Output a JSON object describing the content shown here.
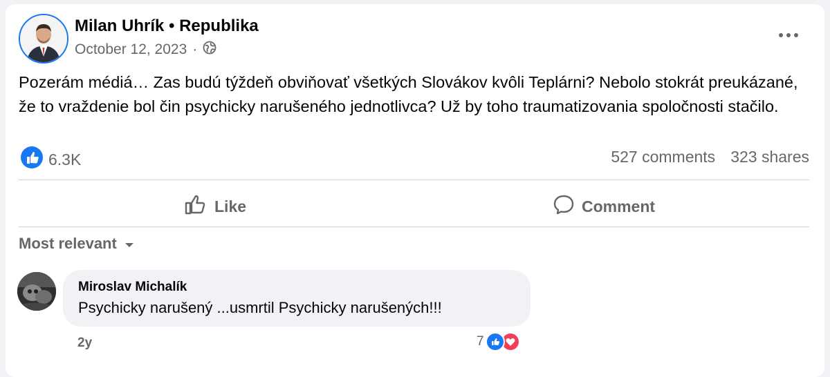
{
  "post": {
    "author": "Milan Uhrík • Republika",
    "date": "October 12, 2023",
    "separator": "·",
    "privacy_icon": "globe-icon",
    "more_icon": "more-options-icon",
    "text": "Pozerám médiá… Zas budú týždeň obviňovať všetkých Slovákov kvôli Teplárni? Nebolo stokrát preukázané, že to vraždenie bol čin psychicky narušeného jednotlivca? Už by toho traumatizovania spoločnosti stačilo.",
    "reaction_count": "6.3K",
    "comments": "527 comments",
    "shares": "323 shares"
  },
  "actions": {
    "like_label": "Like",
    "comment_label": "Comment"
  },
  "comments": {
    "sort_label": "Most relevant",
    "items": [
      {
        "author": "Miroslav Michalík",
        "text": "Psychicky narušený ...usmrtil Psychicky narušených!!!",
        "time": "2y",
        "reaction_count": "7"
      }
    ]
  },
  "colors": {
    "accent": "#1877f2",
    "love": "#f33e58",
    "secondary_text": "#65676b",
    "bubble": "#f0f2f5"
  }
}
